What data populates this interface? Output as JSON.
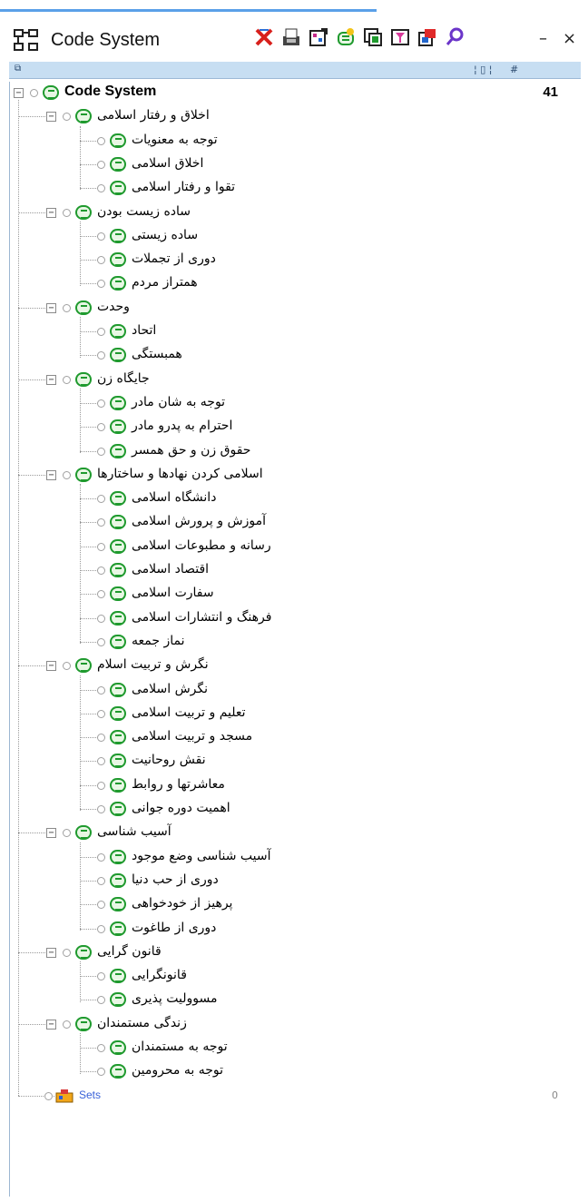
{
  "window": {
    "title": "Code System",
    "minimize_label": "–",
    "close_label": "×"
  },
  "columns": {
    "col1": "¦ ▯ ¦",
    "col2": "#"
  },
  "colors": {
    "accent": "#5aa0e8",
    "code_icon": "#1f9a2e",
    "column_bar": "#c7def2"
  },
  "toolbar": [
    {
      "icon": "delete-codes-icon"
    },
    {
      "icon": "export-icon"
    },
    {
      "icon": "code-matrix-icon"
    },
    {
      "icon": "new-code-icon"
    },
    {
      "icon": "code-relations-icon"
    },
    {
      "icon": "code-filter-icon"
    },
    {
      "icon": "smart-coding-icon"
    },
    {
      "icon": "search-icon"
    }
  ],
  "root": {
    "label": "Code System",
    "count": "41"
  },
  "groups": [
    {
      "label": "اخلاق و رفتار اسلامی",
      "children": [
        "توجه به معنویات",
        "اخلاق اسلامی",
        "تقوا و رفتار اسلامی"
      ]
    },
    {
      "label": "ساده زیست بودن",
      "children": [
        "ساده زیستی",
        "دوری از تجملات",
        "همتراز مردم"
      ]
    },
    {
      "label": "وحدت",
      "children": [
        "اتحاد",
        "همبستگی"
      ]
    },
    {
      "label": "جایگاه زن",
      "children": [
        "توجه به شان مادر",
        "احترام به پدرو مادر",
        "حقوق زن و حق همسر"
      ]
    },
    {
      "label": "اسلامی کردن نهادها و ساختارها",
      "children": [
        "دانشگاه اسلامی",
        "آموزش و پرورش اسلامی",
        "رسانه و مطبوعات اسلامی",
        "اقتصاد اسلامی",
        "سفارت اسلامی",
        "فرهنگ و انتشارات اسلامی",
        "نماز جمعه"
      ]
    },
    {
      "label": "نگرش و تربیت اسلام",
      "children": [
        "نگرش اسلامی",
        "تعلیم و تربیت اسلامی",
        "مسجد و تربیت اسلامی",
        "نقش روحانیت",
        "معاشرتها و روابط",
        "اهمیت دوره جوانی"
      ]
    },
    {
      "label": "آسیب شناسی",
      "children": [
        "آسیب شناسی وضع موجود",
        "دوری از حب دنیا",
        "پرهیز از خودخواهی",
        "دوری از طاغوت"
      ]
    },
    {
      "label": "قانون گرایی",
      "children": [
        "قانونگرایی",
        "مسوولیت پذیری"
      ]
    },
    {
      "label": "زندگی مستمندان",
      "children": [
        "توجه به مستمندان",
        "توجه به محرومین"
      ]
    }
  ],
  "sets": {
    "label": "Sets",
    "count": "0"
  }
}
